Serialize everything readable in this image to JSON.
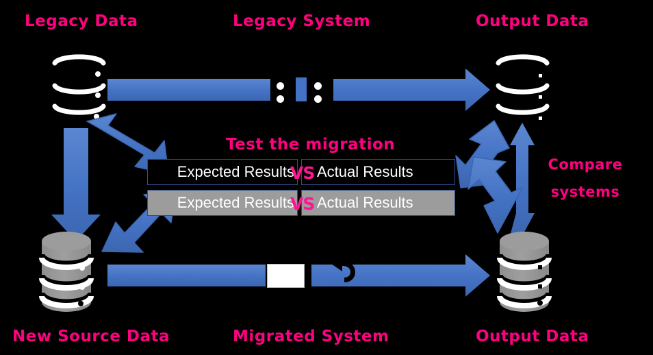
{
  "diagram": {
    "title": "Data migration testing diagram",
    "background_color": "#000000",
    "accent_color": "#FF0080",
    "arrow_color": "#4472C4",
    "gray_color": "#9C9C9C",
    "labels": {
      "legacy_data": "Legacy Data",
      "legacy_system": "Legacy System",
      "output_data_top": "Output Data",
      "new_source_data": "New Source Data",
      "migrated_system": "Migrated System",
      "output_data_bottom": "Output Data",
      "compare_line1": "Compare",
      "compare_line2": "systems",
      "test_the_migration": "Test the migration"
    },
    "comparison": {
      "rows": [
        {
          "style": "dark",
          "left": "Expected Results",
          "vs": "VS",
          "right": "Actual Results"
        },
        {
          "style": "gray",
          "left": "Expected Results",
          "vs": "VS",
          "right": "Actual Results"
        }
      ]
    },
    "nodes": [
      {
        "id": "legacy-data",
        "kind": "database-cylinder",
        "fill": "dark",
        "label": "Legacy Data"
      },
      {
        "id": "output-data-top",
        "kind": "database-cylinder",
        "fill": "dark",
        "label": "Output Data"
      },
      {
        "id": "new-source-data",
        "kind": "database-cylinder",
        "fill": "gray",
        "label": "New Source Data"
      },
      {
        "id": "output-data-bot",
        "kind": "database-cylinder",
        "fill": "gray",
        "label": "Output Data"
      }
    ],
    "connectors": [
      {
        "id": "legacy-pipeline",
        "kind": "right-arrow",
        "from": "legacy-data",
        "to": "output-data-top"
      },
      {
        "id": "migration-pipeline",
        "kind": "right-arrow",
        "from": "new-source-data",
        "to": "output-data-bot"
      },
      {
        "id": "migrate-data",
        "kind": "down-arrow",
        "from": "legacy-data",
        "to": "new-source-data"
      },
      {
        "id": "compare-outputs",
        "kind": "double-arrow",
        "from": "output-data-top",
        "to": "output-data-bot"
      },
      {
        "id": "expected-from-legacy",
        "kind": "diagonal-arrow",
        "from": "legacy-data",
        "to": "expected-results-top"
      },
      {
        "id": "expected-from-new",
        "kind": "diagonal-arrow",
        "from": "new-source-data",
        "to": "expected-results-bottom"
      },
      {
        "id": "actual-from-top",
        "kind": "diagonal-arrow",
        "from": "output-data-top",
        "to": "actual-results-top"
      },
      {
        "id": "actual-from-bottom",
        "kind": "diagonal-arrow",
        "from": "output-data-bot",
        "to": "actual-results-bottom"
      }
    ],
    "icons": {
      "legacy_system_marker": "pause-dots-icon",
      "migrated_system_marker": "return-arrow-icon"
    }
  }
}
